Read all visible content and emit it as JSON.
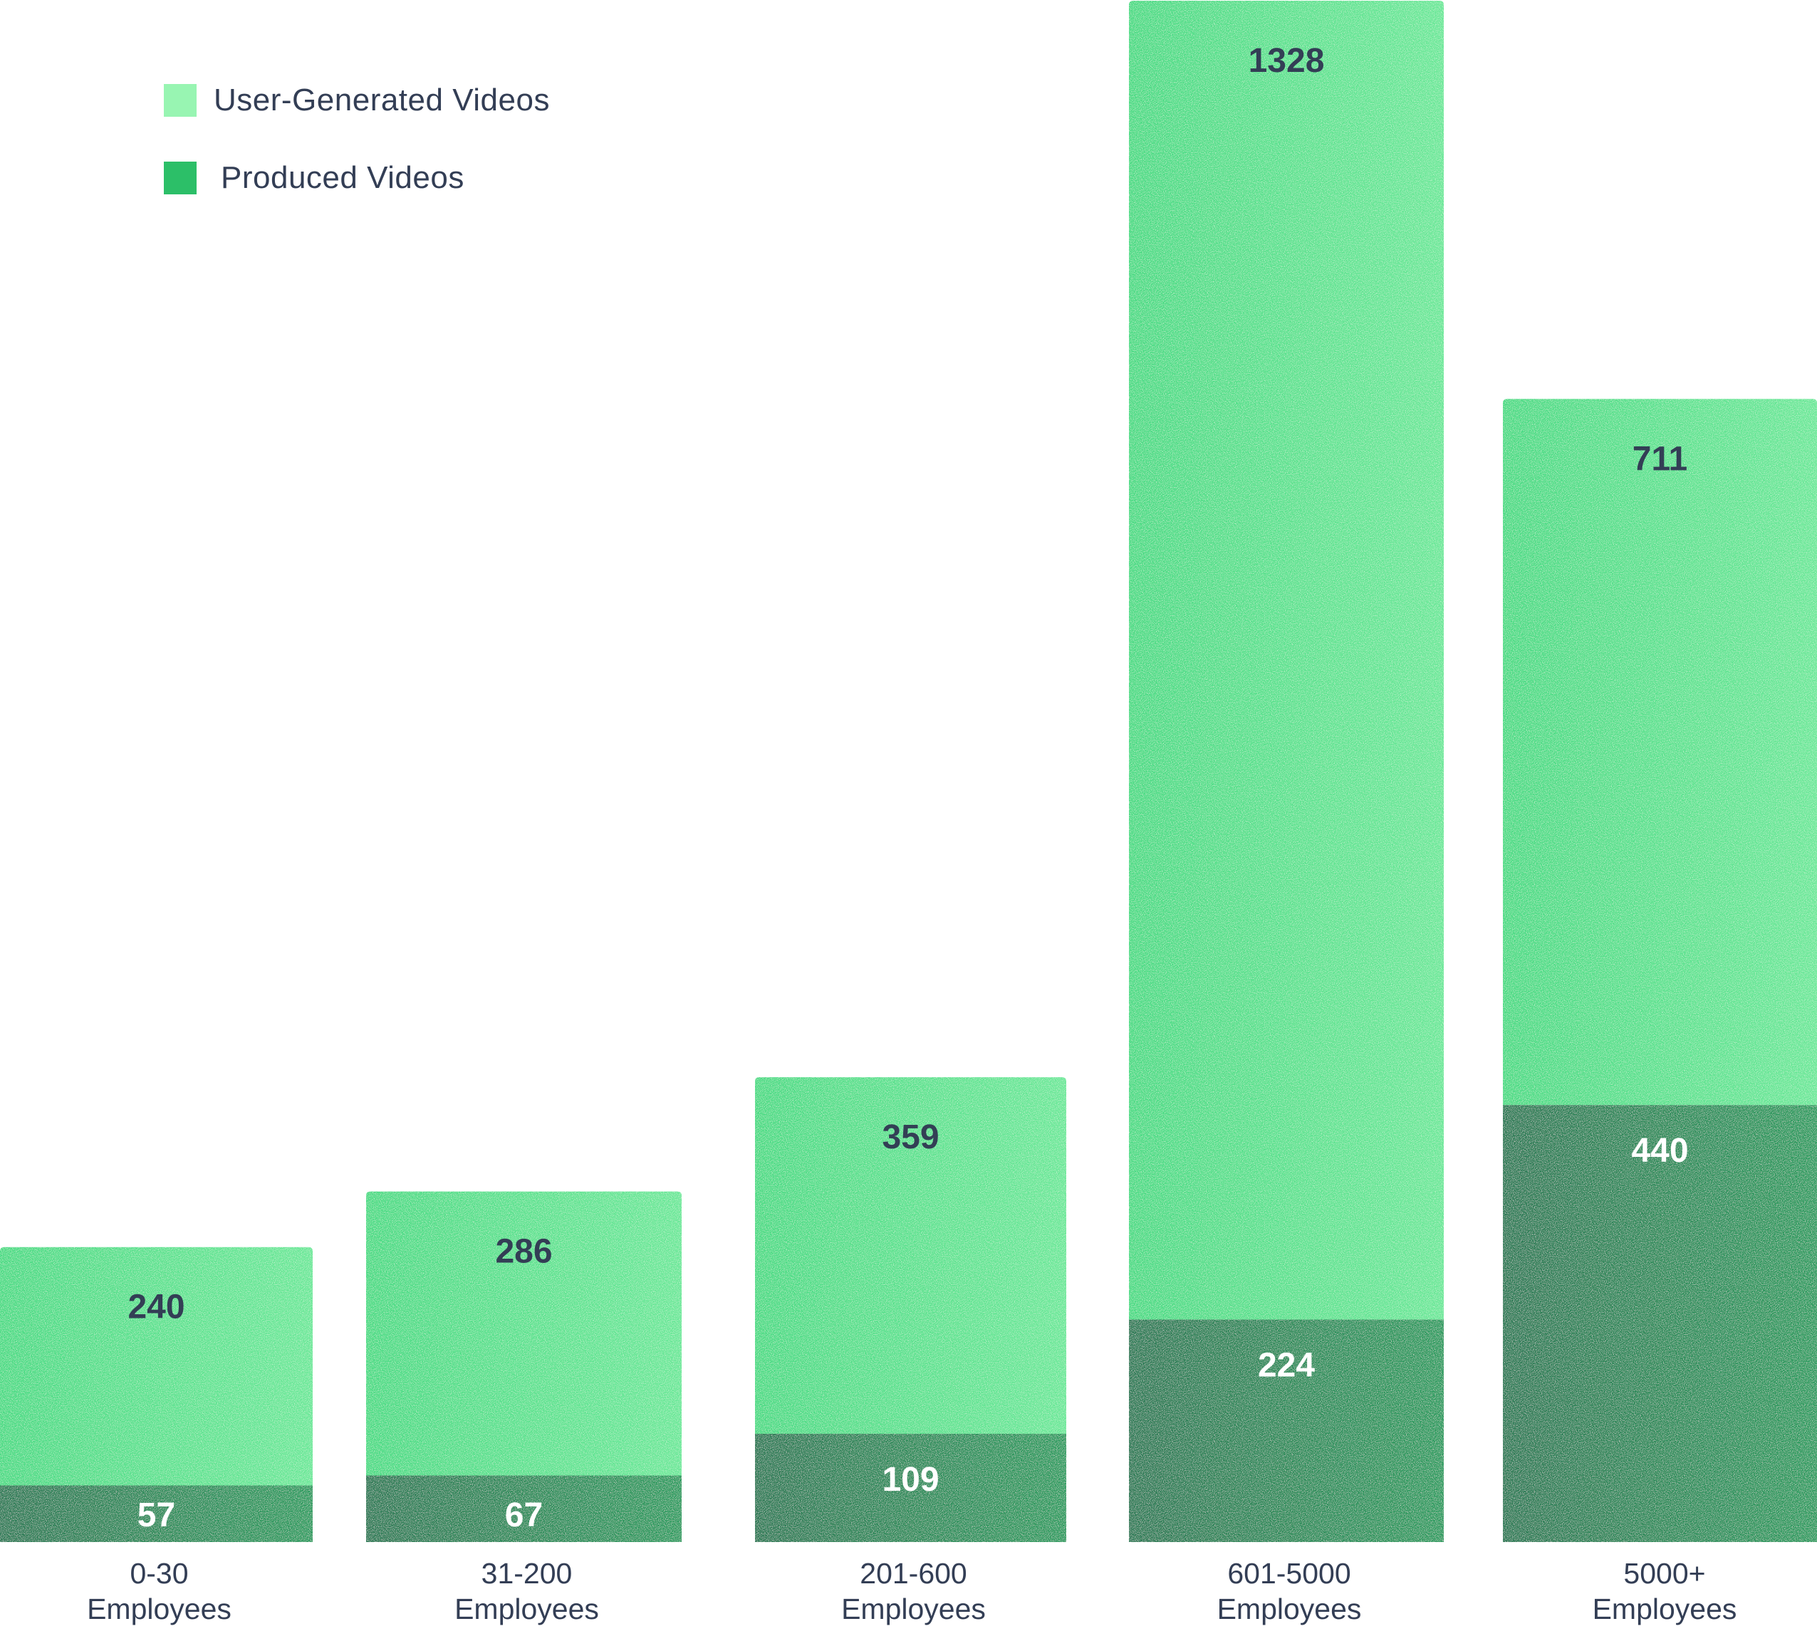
{
  "chart_data": {
    "type": "bar",
    "stacked": true,
    "title": "",
    "xlabel": "",
    "ylabel": "",
    "categories": [
      [
        "0-30",
        "Employees"
      ],
      [
        "31-200",
        "Employees"
      ],
      [
        "201-600",
        "Employees"
      ],
      [
        "601-5000",
        "Employees"
      ],
      [
        "5000+",
        "Employees"
      ]
    ],
    "series": [
      {
        "name": "Produced Videos",
        "values": [
          57,
          67,
          109,
          224,
          440
        ],
        "color": "#2a8f58",
        "legend_color": "#2cbf68",
        "label_color": "#ffffff"
      },
      {
        "name": "User-Generated Videos",
        "values": [
          240,
          286,
          359,
          1328,
          711
        ],
        "color": "#55df8c",
        "legend_color": "#98f5b2",
        "label_color": "#333e55"
      }
    ],
    "legend": {
      "position": "top-left",
      "order": [
        "User-Generated Videos",
        "Produced Videos"
      ]
    },
    "grid": false,
    "ylim": [
      0,
      1552
    ]
  }
}
